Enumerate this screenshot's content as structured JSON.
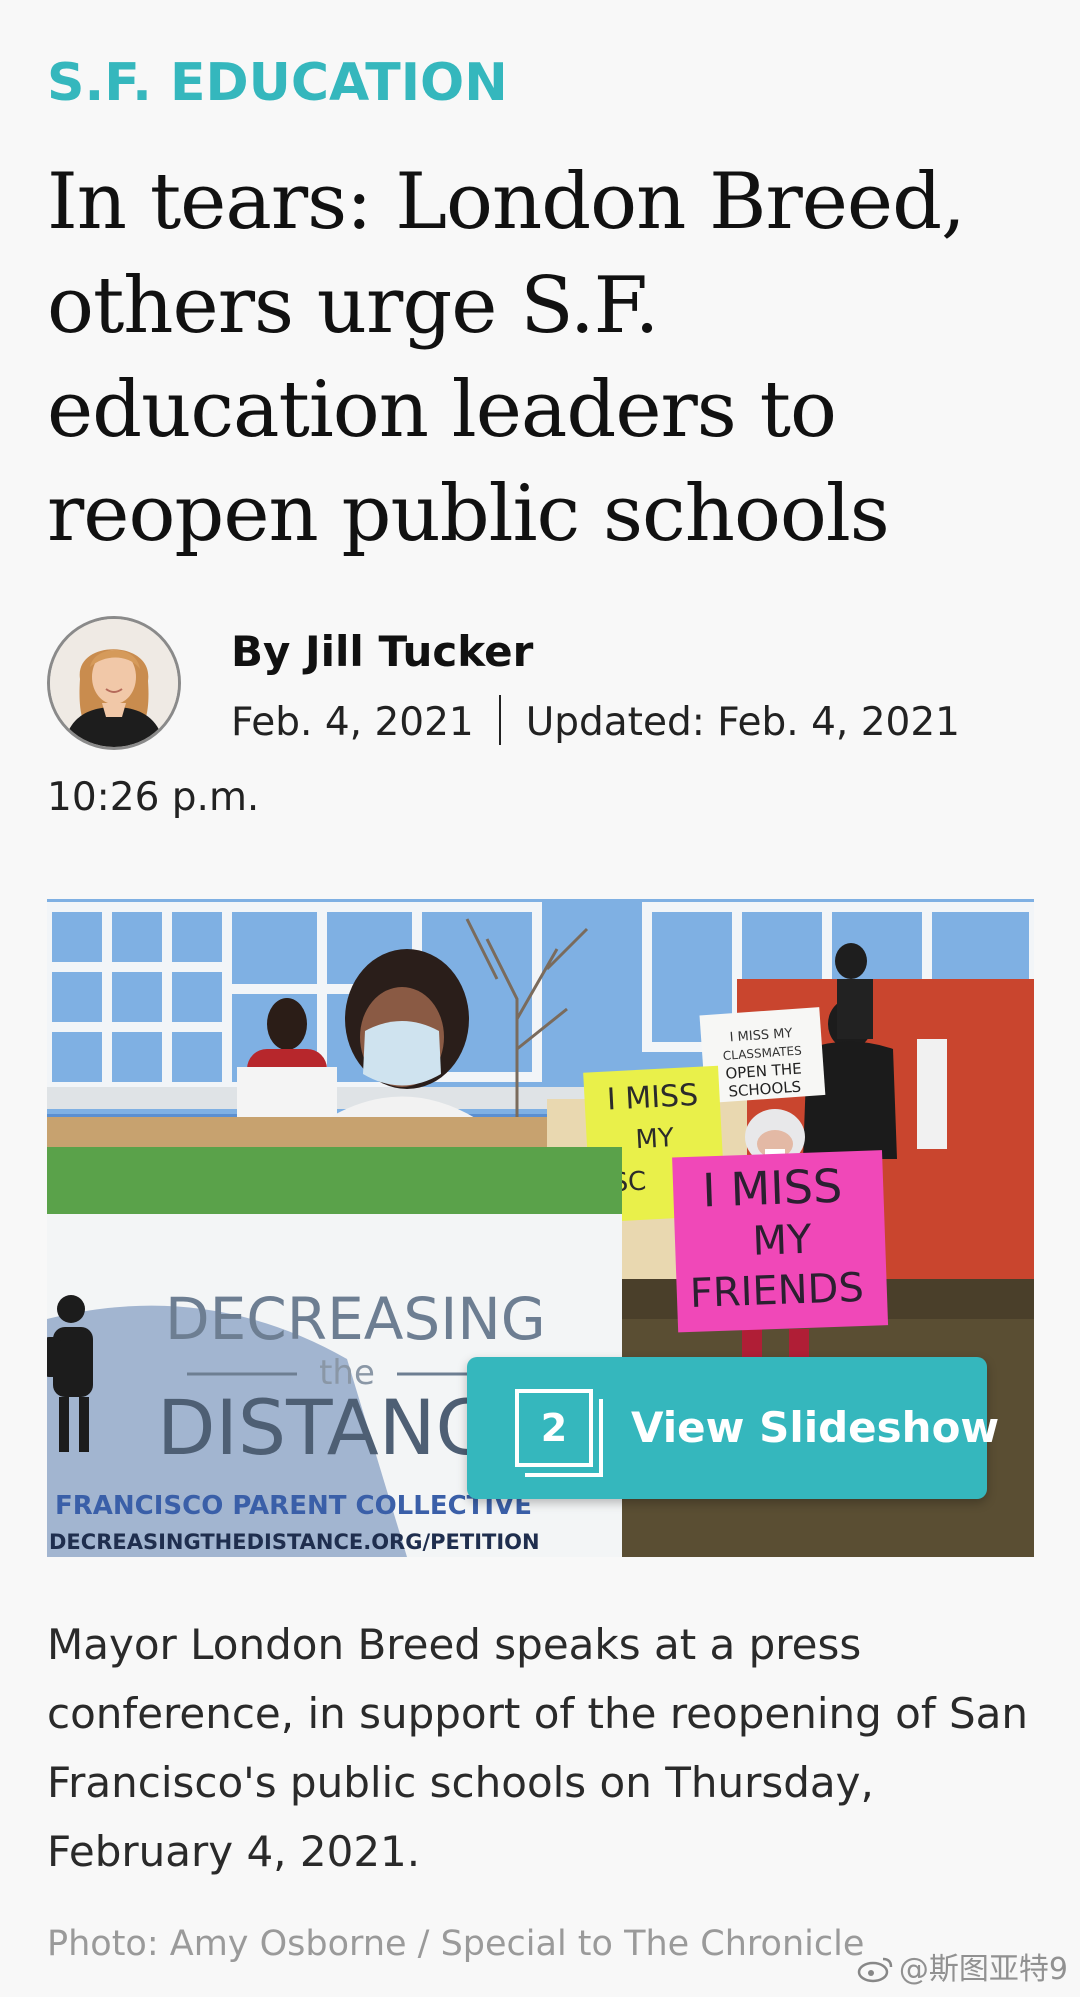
{
  "article": {
    "section": "S.F. EDUCATION",
    "headline": "In tears: London Breed, others urge S.F. education leaders to reopen public schools",
    "author": "By Jill Tucker",
    "published": "Feb. 4, 2021",
    "updated": "Updated: Feb. 4, 2021",
    "updated_time": "10:26 p.m."
  },
  "photo": {
    "slideshow_count": "2",
    "slideshow_label": "View Slideshow",
    "sign_banner_line1": "DECREASING",
    "sign_banner_line2": "the",
    "sign_banner_line3": "DISTANC",
    "sign_banner_org": "FRANCISCO PARENT COLLECTIVE",
    "sign_banner_url": "DECREASINGTHEDISTANCE.ORG/PETITION",
    "sign_pink": "I MISS MY FRIENDS",
    "sign_yellow": "I MISS MY SC",
    "sign_white": "I MISS MY CLASSMATES OPEN THE SCHOOLS",
    "caption": "Mayor London Breed speaks at a press conference, in support of the reopening of San Francisco's public schools on Thursday, February 4, 2021.",
    "credit": "Photo: Amy Osborne / Special to The Chronicle"
  },
  "watermark": "@斯图亚特9",
  "colors": {
    "accent": "#35b7bd",
    "background": "#f8f8f8",
    "headline": "#111111",
    "caption": "#2a2a2a",
    "credit": "#9a9a9a"
  },
  "icons": {
    "slideshow": "stacked-frames-icon",
    "watermark": "weibo-icon"
  }
}
